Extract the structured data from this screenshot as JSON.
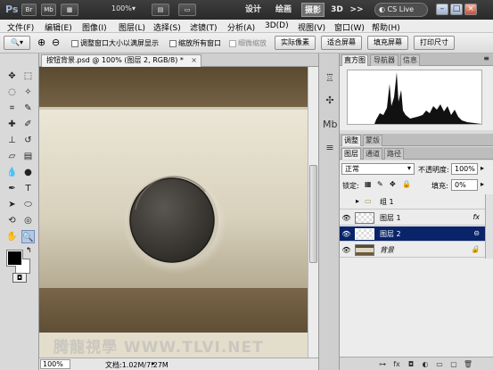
{
  "app": {
    "logo": "Ps",
    "bridge_buttons": [
      "Br",
      "Mb"
    ],
    "zoom_level": "100%",
    "workspaces": [
      "设计",
      "绘画",
      "摄影",
      "3D"
    ],
    "active_workspace": "摄影",
    "more": ">>",
    "cs_live": "CS Live",
    "window_buttons": [
      "–",
      "□",
      "×"
    ]
  },
  "menu": [
    "文件(F)",
    "编辑(E)",
    "图像(I)",
    "图层(L)",
    "选择(S)",
    "滤镜(T)",
    "分析(A)",
    "3D(D)",
    "视图(V)",
    "窗口(W)",
    "帮助(H)"
  ],
  "options": {
    "resize_windows": "调整窗口大小以满屏显示",
    "zoom_all": "缩放所有窗口",
    "scrubby": "细微缩放",
    "actual_pixels": "实际像素",
    "fit_screen": "适合屏幕",
    "fill_screen": "填充屏幕",
    "print_size": "打印尺寸"
  },
  "document": {
    "tab_title": "按钮背景.psd @ 100% (图层 2, RGB/8) *",
    "close": "×",
    "status_zoom": "100%",
    "status_info": "文档:1.02M/7.27M",
    "watermark": "腾龍視學 WWW.TLVI.NET"
  },
  "panels": {
    "histogram_tabs": [
      "直方图",
      "导航器",
      "信息"
    ],
    "adjust_tabs": [
      "调整",
      "蒙版"
    ],
    "layers_tabs": [
      "图层",
      "通道",
      "路径"
    ],
    "blend_mode": "正常",
    "opacity_label": "不透明度:",
    "opacity_value": "100%",
    "lock_label": "锁定:",
    "fill_label": "填充:",
    "fill_value": "0%",
    "layers": [
      {
        "name": "组 1",
        "type": "group",
        "visible": false,
        "right": ""
      },
      {
        "name": "图层 1",
        "type": "layer",
        "visible": true,
        "right": "fx"
      },
      {
        "name": "图层 2",
        "type": "layer",
        "visible": true,
        "right": "",
        "active": true
      },
      {
        "name": "背景",
        "type": "background",
        "visible": true,
        "right": "🔒"
      }
    ]
  },
  "colors": {
    "accent": "#0a246a",
    "band_dark": "#6b5a3e",
    "canvas_light": "#e8e2d0",
    "button": "#3b3834"
  }
}
